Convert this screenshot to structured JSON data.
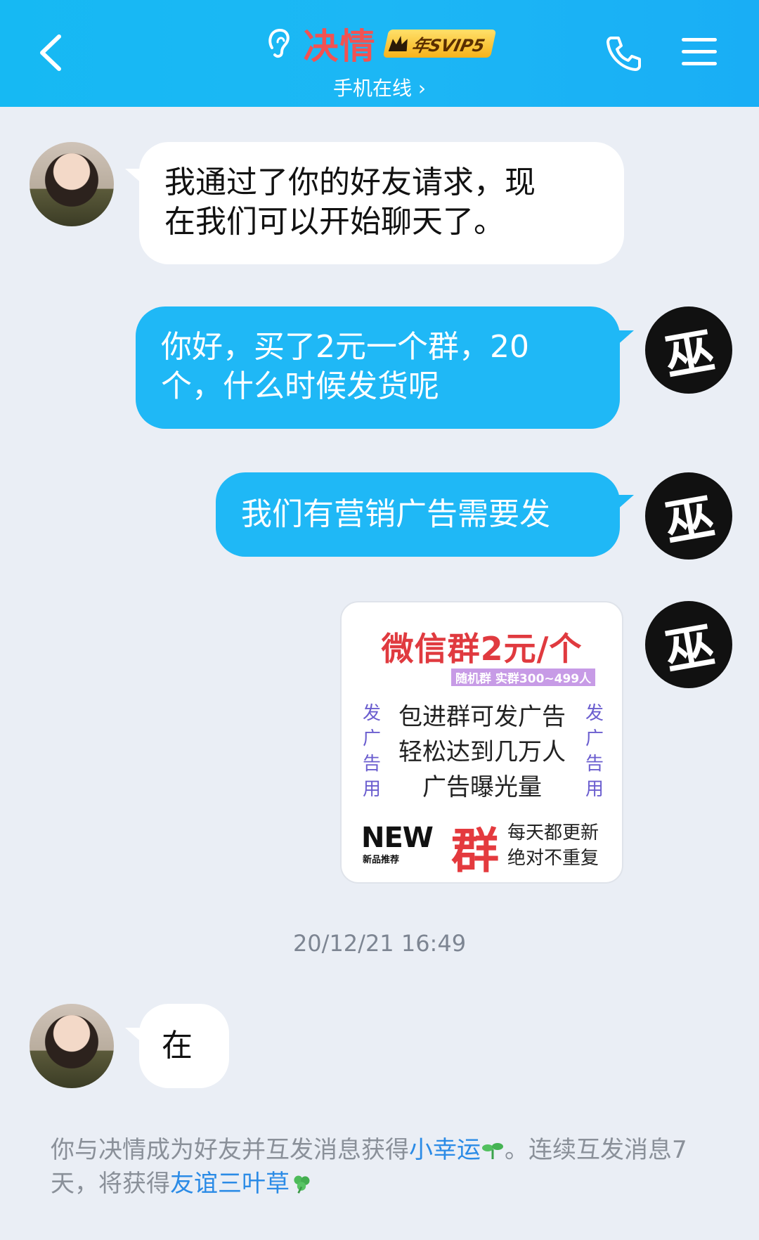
{
  "header": {
    "contact_name": "决情",
    "badge_text": "年SVIP5",
    "status": "手机在线 ›"
  },
  "messages": [
    {
      "side": "in",
      "text_line1": "我通过了你的好友请求，现",
      "text_line2": "在我们可以开始聊天了。"
    },
    {
      "side": "out",
      "text_line1": "你好，买了2元一个群，20",
      "text_line2": "个，什么时候发货呢"
    },
    {
      "side": "out",
      "text": "我们有营销广告需要发"
    },
    {
      "side": "in",
      "text": "在"
    }
  ],
  "image_card": {
    "title": "微信群2元/个",
    "subtitle": "随机群 实群300~499人",
    "side_text": [
      "发",
      "广",
      "告",
      "用"
    ],
    "lines": [
      "包进群可发广告",
      "轻松达到几万人",
      "广告曝光量"
    ],
    "new_logo": "NEW",
    "new_sub": "新品推荐",
    "big_char": "群",
    "right_lines": [
      "每天都更新",
      "绝对不重复"
    ]
  },
  "timestamp": "20/12/21 16:49",
  "notice": {
    "part1": "你与决情成为好友并互发消息获得",
    "link1": "小幸运",
    "part2": "。连续互发消息7天，将获得",
    "link2": "友谊三叶草"
  },
  "colors": {
    "header_bg": "#1cb7f5",
    "outgoing_bubble": "#1fb8f6",
    "incoming_bubble": "#ffffff",
    "name_red": "#f25252",
    "link_blue": "#2b8be6"
  },
  "icons": {
    "back": "chevron-left-icon",
    "ear": "ear-icon",
    "phone": "phone-icon",
    "menu": "menu-icon"
  }
}
